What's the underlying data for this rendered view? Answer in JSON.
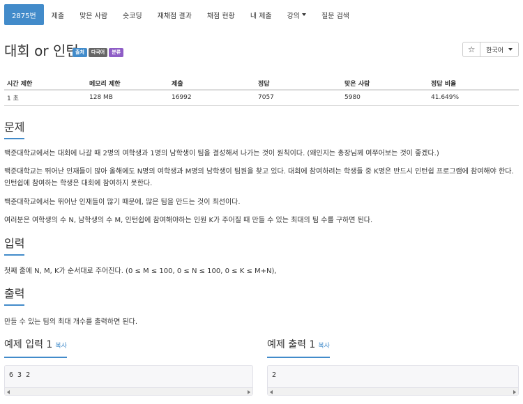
{
  "nav": {
    "problem_id": "2875번",
    "items": [
      "제출",
      "맞은 사람",
      "숏코딩",
      "재채점 결과",
      "채점 현황",
      "내 제출",
      "강의",
      "질문 검색"
    ]
  },
  "title": "대회 or 인턴",
  "badges": [
    {
      "label": "출처",
      "color": "#428bca"
    },
    {
      "label": "다국어",
      "color": "#666666"
    },
    {
      "label": "분류",
      "color": "#8e5dc6"
    }
  ],
  "tools": {
    "star": "☆",
    "language": "한국어"
  },
  "stats": {
    "headers": [
      "시간 제한",
      "메모리 제한",
      "제출",
      "정답",
      "맞은 사람",
      "정답 비율"
    ],
    "values": [
      "1 초",
      "128 MB",
      "16992",
      "7057",
      "5980",
      "41.649%"
    ]
  },
  "sections": {
    "problem": {
      "heading": "문제",
      "paragraphs": [
        "백준대학교에서는 대회에 나갈 때 2명의 여학생과 1명의 남학생이 팀을 결성해서 나가는 것이 원칙이다. (왜인지는 총장님께 여쭈어보는 것이 좋겠다.)",
        "백준대학교는 뛰어난 인재들이 많아 올해에도 N명의 여학생과 M명의 남학생이 팀원을 찾고 있다. 대회에 참여하려는 학생들 중 K명은 반드시 인턴쉽 프로그램에 참여해야 한다. 인턴쉽에 참여하는 학생은 대회에 참여하지 못한다.",
        "백준대학교에서는 뛰어난 인재들이 많기 때문에, 많은 팀을 만드는 것이 최선이다.",
        "여러분은 여학생의 수 N, 남학생의 수 M, 인턴쉽에 참여해야하는 인원 K가 주어질 때 만들 수 있는 최대의 팀 수를 구하면 된다."
      ]
    },
    "input": {
      "heading": "입력",
      "text": "첫째 줄에 N, M, K가 순서대로 주어진다. (0 ≤ M ≤ 100, 0 ≤ N ≤ 100, 0 ≤ K ≤ M+N),"
    },
    "output": {
      "heading": "출력",
      "text": "만들 수 있는 팀의 최대 개수를 출력하면 된다."
    }
  },
  "samples": {
    "input_title": "예제 입력 1",
    "output_title": "예제 출력 1",
    "copy_label": "복사",
    "input_value": "6 3 2",
    "output_value": "2"
  }
}
